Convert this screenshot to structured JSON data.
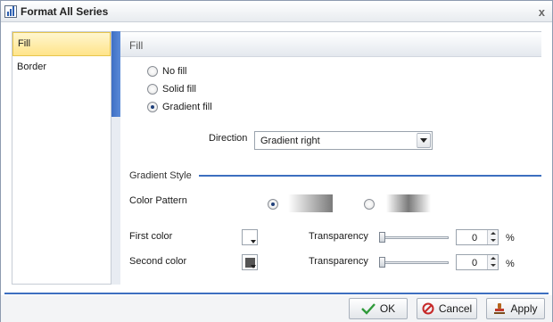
{
  "window": {
    "title": "Format All Series",
    "close_glyph": "x"
  },
  "nav": {
    "items": [
      {
        "label": "Fill",
        "active": true
      },
      {
        "label": "Border",
        "active": false
      }
    ]
  },
  "fill": {
    "header": "Fill",
    "options": [
      {
        "label": "No fill",
        "selected": false
      },
      {
        "label": "Solid fill",
        "selected": false
      },
      {
        "label": "Gradient fill",
        "selected": true
      }
    ],
    "direction_label": "Direction",
    "direction_value": "Gradient right",
    "gradient_style_title": "Gradient Style",
    "color_pattern_label": "Color Pattern",
    "color_pattern_selected": 1,
    "first_color_label": "First color",
    "first_color": "#ffffff",
    "second_color_label": "Second color",
    "second_color": "#555555",
    "transparency_label": "Transparency",
    "first_transparency": "0",
    "second_transparency": "0",
    "percent": "%"
  },
  "buttons": {
    "ok": "OK",
    "cancel": "Cancel",
    "apply": "Apply"
  },
  "colors": {
    "accent": "#3d6fc0",
    "nav_active": "#ffe48a"
  }
}
